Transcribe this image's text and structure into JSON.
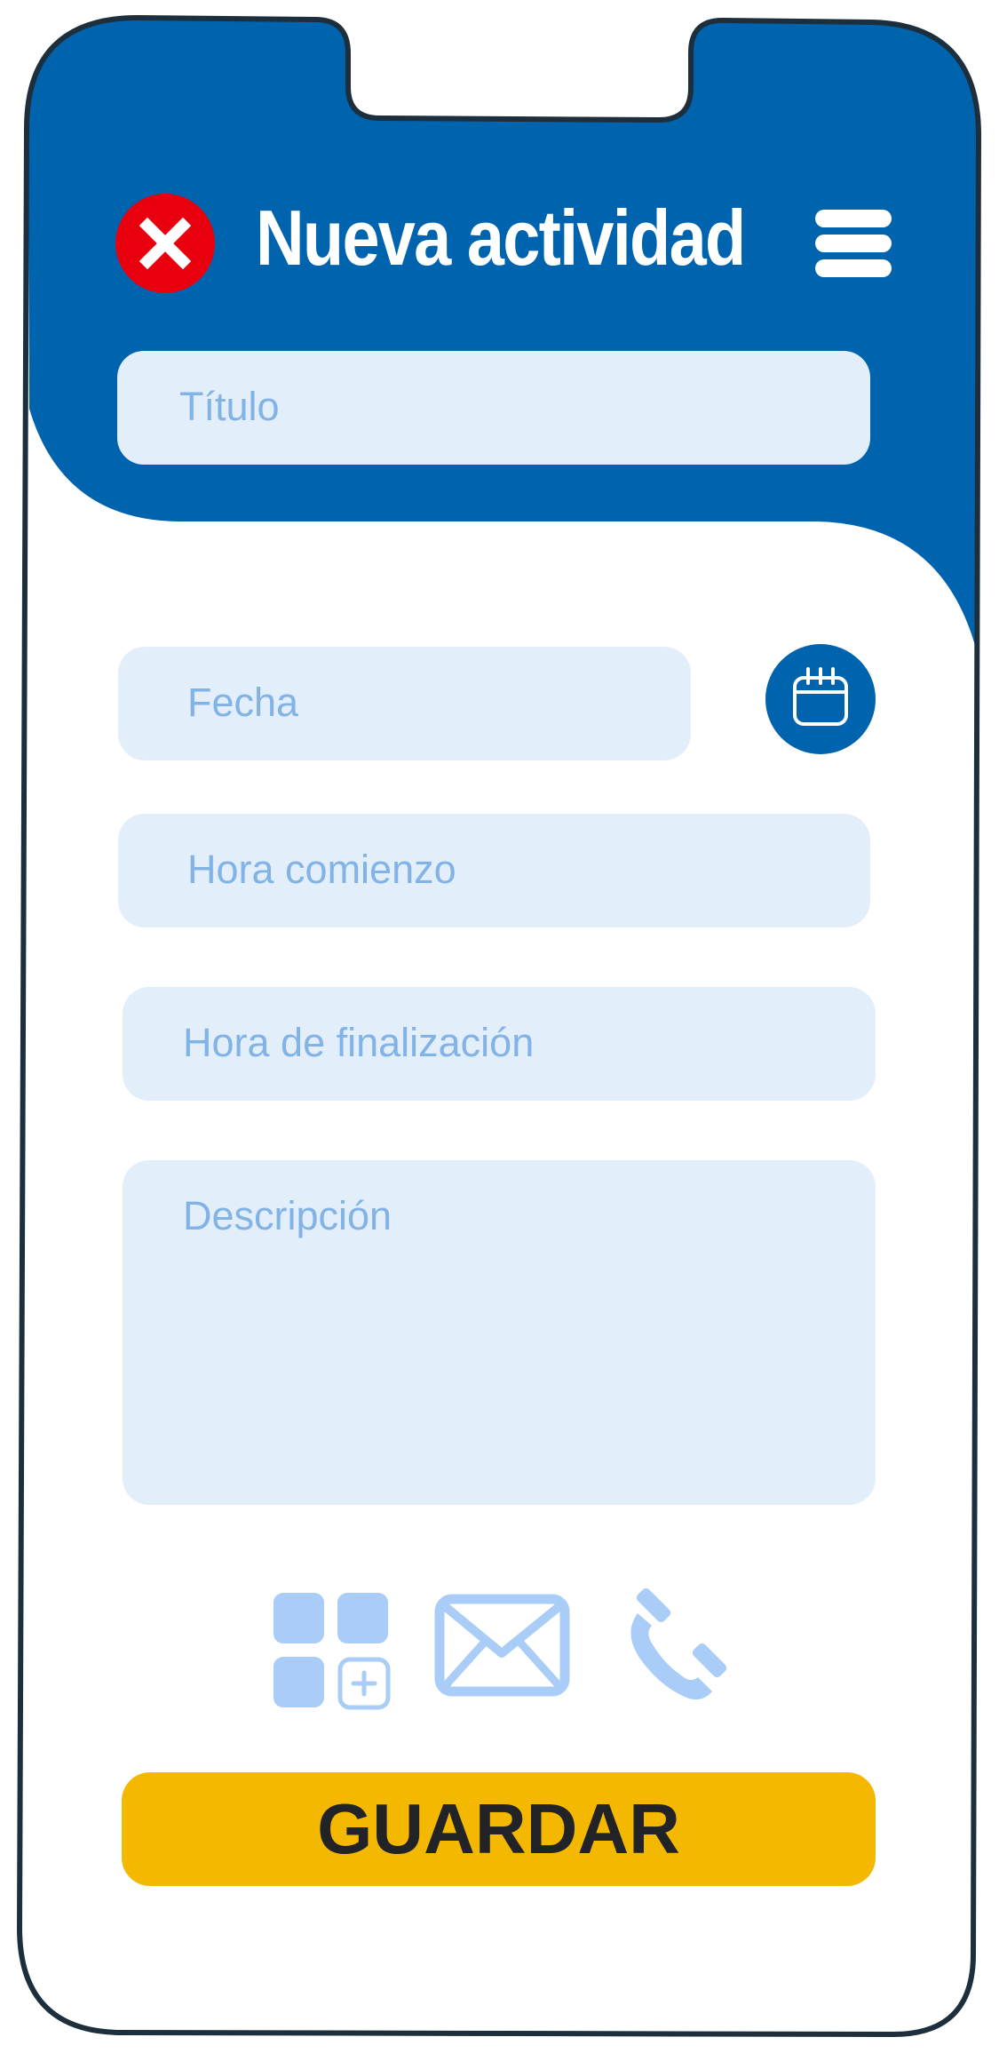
{
  "header": {
    "title": "Nueva actividad",
    "close_icon": "close-icon",
    "menu_icon": "hamburger-menu-icon"
  },
  "form": {
    "title_placeholder": "Título",
    "date_placeholder": "Fecha",
    "start_time_placeholder": "Hora comienzo",
    "end_time_placeholder": "Hora de finalización",
    "description_placeholder": "Descripción",
    "calendar_icon": "calendar-icon"
  },
  "actions": {
    "icons": [
      "add-app-icon",
      "mail-icon",
      "phone-icon"
    ]
  },
  "save_button": {
    "label": "GUARDAR"
  },
  "colors": {
    "header_blue": "#0063ae",
    "field_bg": "#e2eefa",
    "placeholder": "#82b3e6",
    "icon_light_blue": "#a9cdf7",
    "close_red": "#e8000f",
    "save_yellow": "#f5b800",
    "frame_stroke": "#1d2f3c"
  }
}
